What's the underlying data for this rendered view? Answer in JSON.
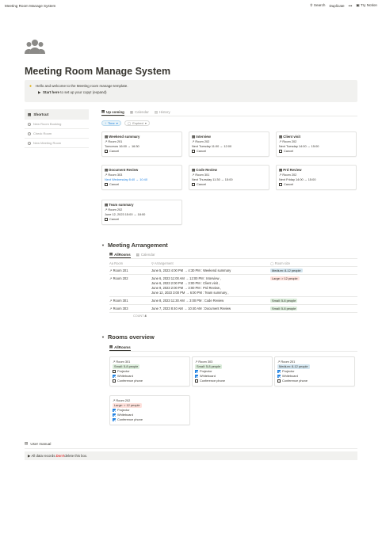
{
  "topbar": {
    "page_name": "Meeting Room Manage System",
    "search": "Search",
    "duplicate": "Duplicate",
    "more": "•••",
    "try_notion": "Try Notion"
  },
  "page": {
    "title": "Meeting Room Manage System"
  },
  "callout": {
    "line1": "Hello and welcome to the Meeting room manage template.",
    "start_bold": "Start here",
    "start_rest": " to set up your copy! (expand)"
  },
  "sidebar": {
    "header": "Shortcut",
    "items": [
      {
        "label": "New Room Booking"
      },
      {
        "label": "Check Room"
      },
      {
        "label": "New Meeting Room"
      }
    ]
  },
  "upcoming": {
    "tabs": [
      {
        "label": "Up coming"
      },
      {
        "label": "Calendar"
      },
      {
        "label": "History"
      }
    ],
    "filters": {
      "time": "Time",
      "expired": "Expired"
    },
    "cancel_label": "Cancel",
    "cards": [
      {
        "title": "Weekend summary",
        "room": "Room 201",
        "time": "Tomorrow 16:00 → 16:30"
      },
      {
        "title": "Interview",
        "room": "Room 202",
        "time": "Next Tuesday 11:00 → 12:00"
      },
      {
        "title": "Client visit",
        "room": "Room 202",
        "time": "Next Tuesday 14:00 → 15:00"
      },
      {
        "title": "Document Review",
        "room": "Room 303",
        "time": "Next Wednesday 8:40 → 10:40"
      },
      {
        "title": "Code Review",
        "room": "Room 301",
        "time": "Next Thursday 11:30 → 15:00"
      },
      {
        "title": "Prd Review",
        "room": "Room 202",
        "time": "Next Friday 14:00 → 15:00"
      },
      {
        "title": "Team summary",
        "room": "Room 202",
        "time": "June 12, 2023 15:00 → 18:00"
      }
    ]
  },
  "arrangement": {
    "title": "Meeting Arrangement",
    "tabs": [
      {
        "label": "AllRooms"
      },
      {
        "label": "Calendar"
      }
    ],
    "headers": {
      "room": "Room",
      "arrangement": "Arrangement",
      "size": "Room size"
    },
    "rows": [
      {
        "room": "Room 201",
        "lines": [
          "June 5, 2023 4:00 PM → 4:30 PM : Weekend summary"
        ],
        "size": "Medium: 8-12 people"
      },
      {
        "room": "Room 202",
        "lines": [
          "June 6, 2023 11:00 AM → 12:00 PM : Interview ,",
          "June 6, 2023 2:00 PM → 3:00 PM : Client visit ,",
          "June 9, 2023 2:00 PM → 3:00 PM : Prd Review ,",
          "June 12, 2023 3:00 PM → 6:00 PM : Team summary ,"
        ],
        "size": "Large: > 12 people"
      },
      {
        "room": "Room 301",
        "lines": [
          "June 8, 2023 11:30 AM → 3:00 PM : Code Review"
        ],
        "size": "Small: 5-8 people"
      },
      {
        "room": "Room 303",
        "lines": [
          "June 7, 2023 8:40 AM → 10:40 AM : Document Review"
        ],
        "size": "Small: 5-8 people"
      }
    ],
    "count_label": "COUNT",
    "count_value": "4"
  },
  "overview": {
    "title": "Rooms overview",
    "tab": "AllRooms",
    "feature_labels": {
      "projector": "Projector",
      "whiteboard": "Whiteboard",
      "phone": "Conference phone"
    },
    "rooms": [
      {
        "name": "Room 301",
        "size": "Small: 5-8 people",
        "projector": false,
        "whiteboard": true,
        "phone": false
      },
      {
        "name": "Room 303",
        "size": "Small: 5-8 people",
        "projector": true,
        "whiteboard": true,
        "phone": false
      },
      {
        "name": "Room 201",
        "size": "Medium: 8-12 people",
        "projector": true,
        "whiteboard": true,
        "phone": false
      },
      {
        "name": "Room 202",
        "size": "Large: > 12 people",
        "projector": true,
        "whiteboard": true,
        "phone": true
      }
    ]
  },
  "footer": {
    "manual": "User manual",
    "records_pre": "All data records. ",
    "records_bold": "Don't",
    "records_post": " delete this box."
  },
  "colors": {
    "small": "#dbeddb",
    "medium": "#d3e5ef",
    "large": "#ffe2dd",
    "accent": "#2383e2"
  }
}
